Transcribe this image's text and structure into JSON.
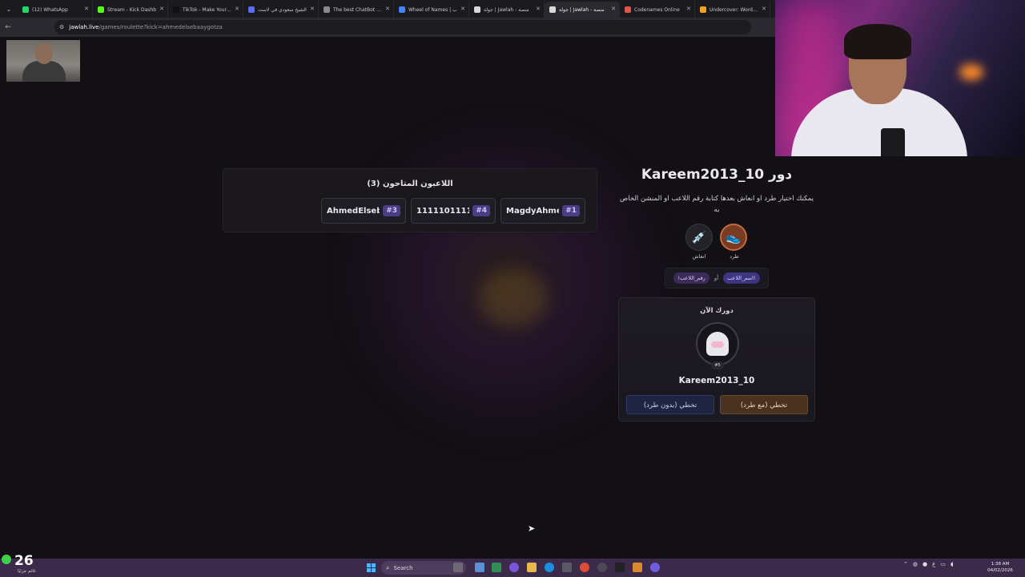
{
  "browser": {
    "tabs": [
      {
        "label": "(12) WhatsApp",
        "color": "#25d366"
      },
      {
        "label": "Stream - Kick Dashb",
        "color": "#53fc18"
      },
      {
        "label": "TikTok - Make Your D",
        "color": "#111111"
      },
      {
        "label": "الشيخ سعودي في لاست",
        "color": "#5a6cf0"
      },
      {
        "label": "The best ChatBot an",
        "color": "#8a8a8a"
      },
      {
        "label": "Wheel of Names | ب",
        "color": "#4285f4"
      },
      {
        "label": "جولة | Jawlah - منصة",
        "color": "#d8d8d8"
      },
      {
        "label": "جولة | Jawlah - منصة",
        "color": "#d8d8d8"
      },
      {
        "label": "Codenames Online",
        "color": "#e0554a"
      },
      {
        "label": "Undercover: Word Pa",
        "color": "#f2a11f"
      }
    ],
    "active_tab_index": 7,
    "url_host": "jawlah.live",
    "url_path": "/games/roulette?kick=ahmedelsebaaygotza"
  },
  "players_panel": {
    "title": "اللاعبون المتاحون (3)",
    "players": [
      {
        "name": "AhmedElseb...",
        "number": "#3"
      },
      {
        "name": "1111101111...",
        "number": "#4"
      },
      {
        "name": "MagdyAhmed...",
        "number": "#1"
      }
    ]
  },
  "turn": {
    "title": "دور Kareem2013_10",
    "description": "يمكنك اختيار طرد او انعاش بعدها كتابة رقم اللاعب او المنشن الخاص به",
    "actions": [
      {
        "label": "طرد",
        "icon": "boot-icon"
      },
      {
        "label": "انعاش",
        "icon": "syringe-icon"
      }
    ],
    "syntax": {
      "by_name": "!اسم_اللاعب",
      "or": "أو",
      "by_number": "رقم_اللاعب!"
    },
    "current": {
      "label": "دورك الآن",
      "player_name": "Kareem2013_10",
      "player_number": "#5",
      "skip_with_kick": "تخطي (مع طرد)",
      "skip_without_kick": "تخطي (بدون طرد)"
    }
  },
  "taskbar": {
    "weather_temp": "26",
    "weather_desc": "غائم جزئيًا",
    "search_placeholder": "Search",
    "clock_time": "1:38 AM",
    "clock_date": "04/02/2026",
    "tray_lang": "ع"
  }
}
